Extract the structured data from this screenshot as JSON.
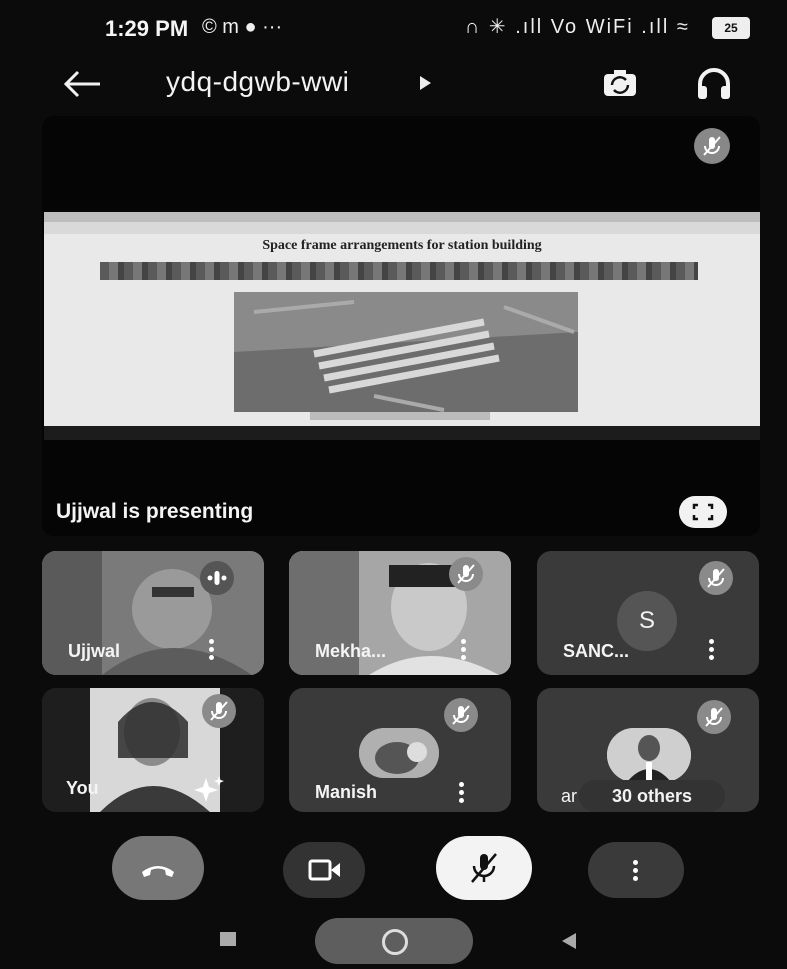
{
  "status_bar": {
    "time": "1:29 PM",
    "left_icons": "© m ● ···",
    "right_icons": "∩ ✳ .ıll Vo WiFi .ıll ≈",
    "battery": "25"
  },
  "app_bar": {
    "meeting_code": "ydq-dgwb-wwi"
  },
  "presentation": {
    "slide_title": "Space frame arrangements for station building",
    "presenting_label": "Ujjwal is presenting"
  },
  "participants": [
    {
      "name": "Ujjwal",
      "muted": false,
      "speaking": true
    },
    {
      "name": "Mekha...",
      "muted": true
    },
    {
      "name": "SANC...",
      "muted": true,
      "avatar_letter": "S"
    },
    {
      "name": "You",
      "muted": true
    },
    {
      "name": "Manish",
      "muted": true
    },
    {
      "name": "ar",
      "muted": true,
      "others_label": "30 others"
    }
  ],
  "colors": {
    "background": "#0b0b0b",
    "tile": "#3a3a3a",
    "muted_badge": "#8a8a8a",
    "mic_button": "#f3f3f3"
  },
  "icons": {
    "back": "arrow-left",
    "play": "triangle-right",
    "switch_camera": "camera-rotate",
    "audio": "headphones",
    "muted": "mic-off",
    "fullscreen": "fullscreen",
    "speaking": "audio-bars",
    "more": "kebab",
    "effects": "sparkle",
    "end_call": "phone-hangup",
    "camera": "videocam",
    "nav_recents": "square",
    "nav_home": "circle",
    "nav_back": "triangle-left"
  }
}
